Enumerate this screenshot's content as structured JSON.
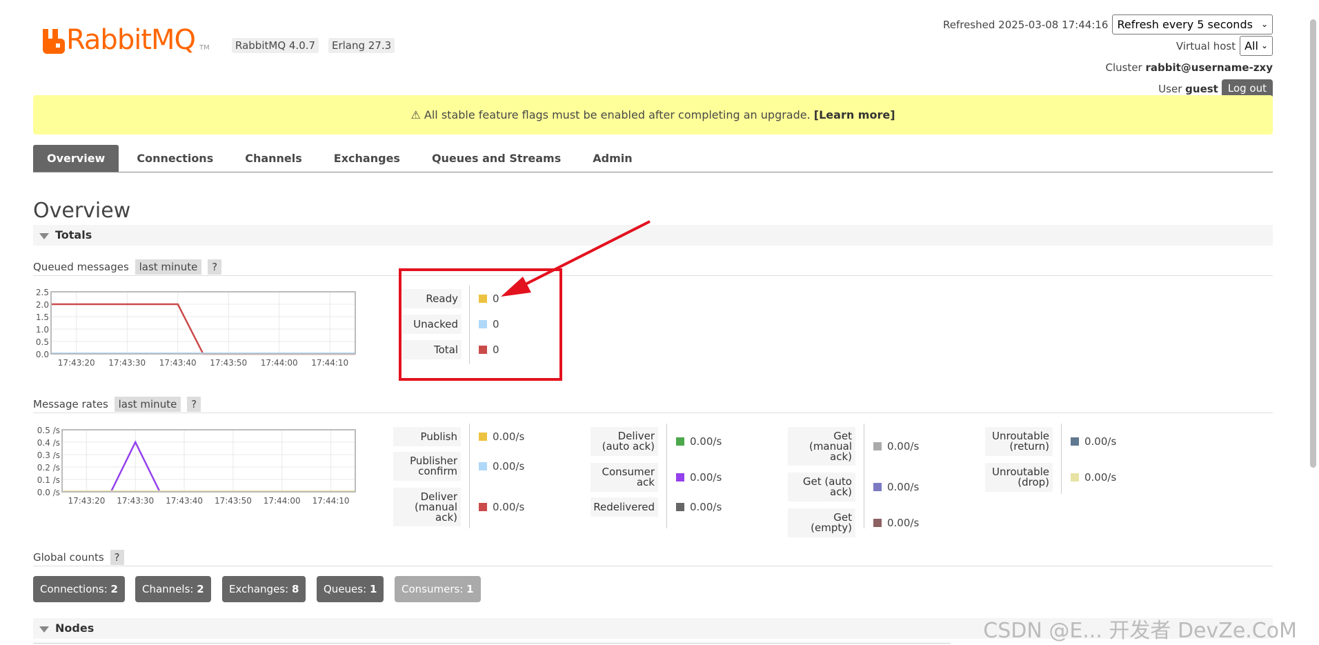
{
  "app": {
    "brand_name": "RabbitMQ",
    "tm": "TM",
    "version_badge": "RabbitMQ 4.0.7",
    "erlang_badge": "Erlang 27.3",
    "brand_color": "#f60"
  },
  "header": {
    "refreshed_label": "Refreshed 2025-03-08 17:44:16",
    "refresh_select": "Refresh every 5 seconds",
    "vhost_label": "Virtual host",
    "vhost_select": "All",
    "cluster_label": "Cluster",
    "cluster_name": "rabbit@username-zxy",
    "user_label": "User",
    "user_name": "guest",
    "logout_label": "Log out"
  },
  "banner": {
    "text": "⚠ All stable feature flags must be enabled after completing an upgrade.",
    "link": "[Learn more]"
  },
  "tabs": [
    {
      "label": "Overview",
      "active": true
    },
    {
      "label": "Connections"
    },
    {
      "label": "Channels"
    },
    {
      "label": "Exchanges"
    },
    {
      "label": "Queues and Streams"
    },
    {
      "label": "Admin"
    }
  ],
  "page_title": "Overview",
  "totals_section": "Totals",
  "queued": {
    "label": "Queued messages",
    "range": "last minute",
    "help": "?",
    "legend": [
      {
        "label": "Ready",
        "value": "0",
        "color": "#edc240"
      },
      {
        "label": "Unacked",
        "value": "0",
        "color": "#afd8f8"
      },
      {
        "label": "Total",
        "value": "0",
        "color": "#cb4b4b"
      }
    ]
  },
  "rates": {
    "label": "Message rates",
    "range": "last minute",
    "help": "?",
    "groups": [
      [
        {
          "label": "Publish",
          "value": "0.00/s",
          "color": "#edc240"
        },
        {
          "label": "Publisher confirm",
          "value": "0.00/s",
          "color": "#afd8f8"
        },
        {
          "label": "Deliver (manual ack)",
          "value": "0.00/s",
          "color": "#cb4b4b"
        }
      ],
      [
        {
          "label": "Deliver (auto ack)",
          "value": "0.00/s",
          "color": "#4da74d"
        },
        {
          "label": "Consumer ack",
          "value": "0.00/s",
          "color": "#9440ed"
        },
        {
          "label": "Redelivered",
          "value": "0.00/s",
          "color": "#666666"
        }
      ],
      [
        {
          "label": "Get (manual ack)",
          "value": "0.00/s",
          "color": "#aaaaaa"
        },
        {
          "label": "Get (auto ack)",
          "value": "0.00/s",
          "color": "#7c79c3"
        },
        {
          "label": "Get (empty)",
          "value": "0.00/s",
          "color": "#8d6262"
        }
      ],
      [
        {
          "label": "Unroutable (return)",
          "value": "0.00/s",
          "color": "#607890"
        },
        {
          "label": "Unroutable (drop)",
          "value": "0.00/s",
          "color": "#e8e2a4"
        }
      ]
    ]
  },
  "global": {
    "label": "Global counts",
    "help": "?",
    "counts": [
      {
        "label": "Connections:",
        "value": "2"
      },
      {
        "label": "Channels:",
        "value": "2"
      },
      {
        "label": "Exchanges:",
        "value": "8"
      },
      {
        "label": "Queues:",
        "value": "1"
      },
      {
        "label": "Consumers:",
        "value": "1",
        "muted": true
      }
    ]
  },
  "nodes_section": "Nodes",
  "watermark": "CSDN @E... 开发者 DevZe.CoM",
  "chart_data": [
    {
      "type": "line",
      "x": [
        "17:43:20",
        "17:43:30",
        "17:43:40",
        "17:43:50",
        "17:44:00",
        "17:44:10"
      ],
      "ylim": [
        0,
        2.5
      ],
      "yticks": [
        "0.0",
        "0.5",
        "1.0",
        "1.5",
        "2.0",
        "2.5"
      ],
      "xlim": [
        -5,
        55
      ],
      "series": [
        {
          "color": "#cb4b4b",
          "points": [
            [
              -5,
              2
            ],
            [
              20,
              2
            ],
            [
              25,
              0
            ],
            [
              55,
              0
            ]
          ]
        },
        {
          "color": "#afd8f8",
          "points": [
            [
              -5,
              0.02
            ],
            [
              55,
              0.02
            ]
          ]
        }
      ]
    },
    {
      "type": "line",
      "x": [
        "17:43:20",
        "17:43:30",
        "17:43:40",
        "17:43:50",
        "17:44:00",
        "17:44:10"
      ],
      "ylim": [
        0,
        0.5
      ],
      "yticks": [
        "0.0 /s",
        "0.1 /s",
        "0.2 /s",
        "0.3 /s",
        "0.4 /s",
        "0.5 /s"
      ],
      "xlim": [
        -5,
        55
      ],
      "series": [
        {
          "color": "#9440ed",
          "points": [
            [
              5,
              0
            ],
            [
              10,
              0.4
            ],
            [
              15,
              0
            ]
          ]
        },
        {
          "color": "#e8e2a4",
          "points": [
            [
              -5,
              0.005
            ],
            [
              55,
              0.005
            ]
          ]
        }
      ]
    }
  ]
}
